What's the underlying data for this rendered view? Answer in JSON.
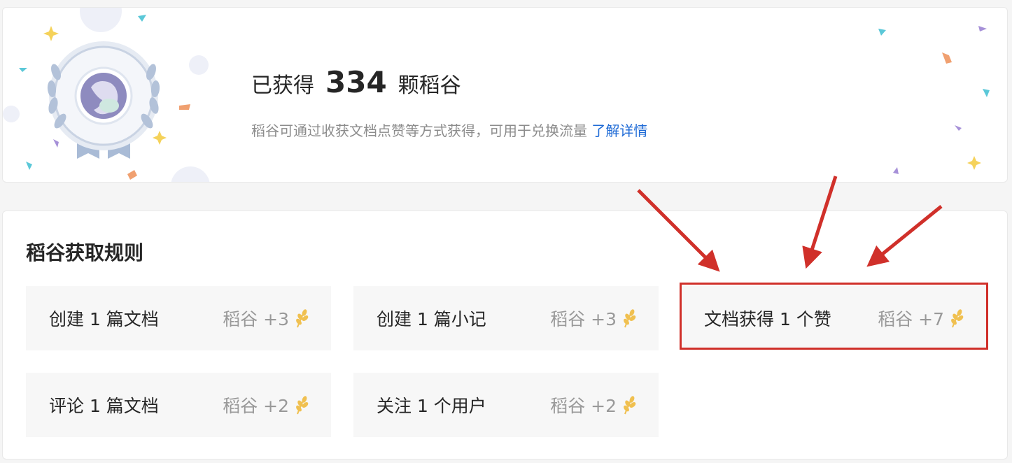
{
  "summary": {
    "prefix": "已获得",
    "count": "334",
    "suffix": "颗稻谷",
    "description": "稻谷可通过收获文档点赞等方式获得，可用于兑换流量",
    "learn_more": "了解详情"
  },
  "rules": {
    "title": "稻谷获取规则",
    "items": [
      {
        "name": "创建 1 篇文档",
        "reward": "稻谷 +3"
      },
      {
        "name": "创建 1 篇小记",
        "reward": "稻谷 +3"
      },
      {
        "name": "文档获得 1 个赞",
        "reward": "稻谷 +7"
      },
      {
        "name": "评论 1 篇文档",
        "reward": "稻谷 +2"
      },
      {
        "name": "关注 1 个用户",
        "reward": "稻谷 +2"
      }
    ]
  },
  "colors": {
    "link": "#1f6bd6",
    "highlight": "#d0302a",
    "wheat": "#f0c050"
  },
  "icons": {
    "badge": "medal-badge-icon",
    "reward": "wheat-icon"
  }
}
